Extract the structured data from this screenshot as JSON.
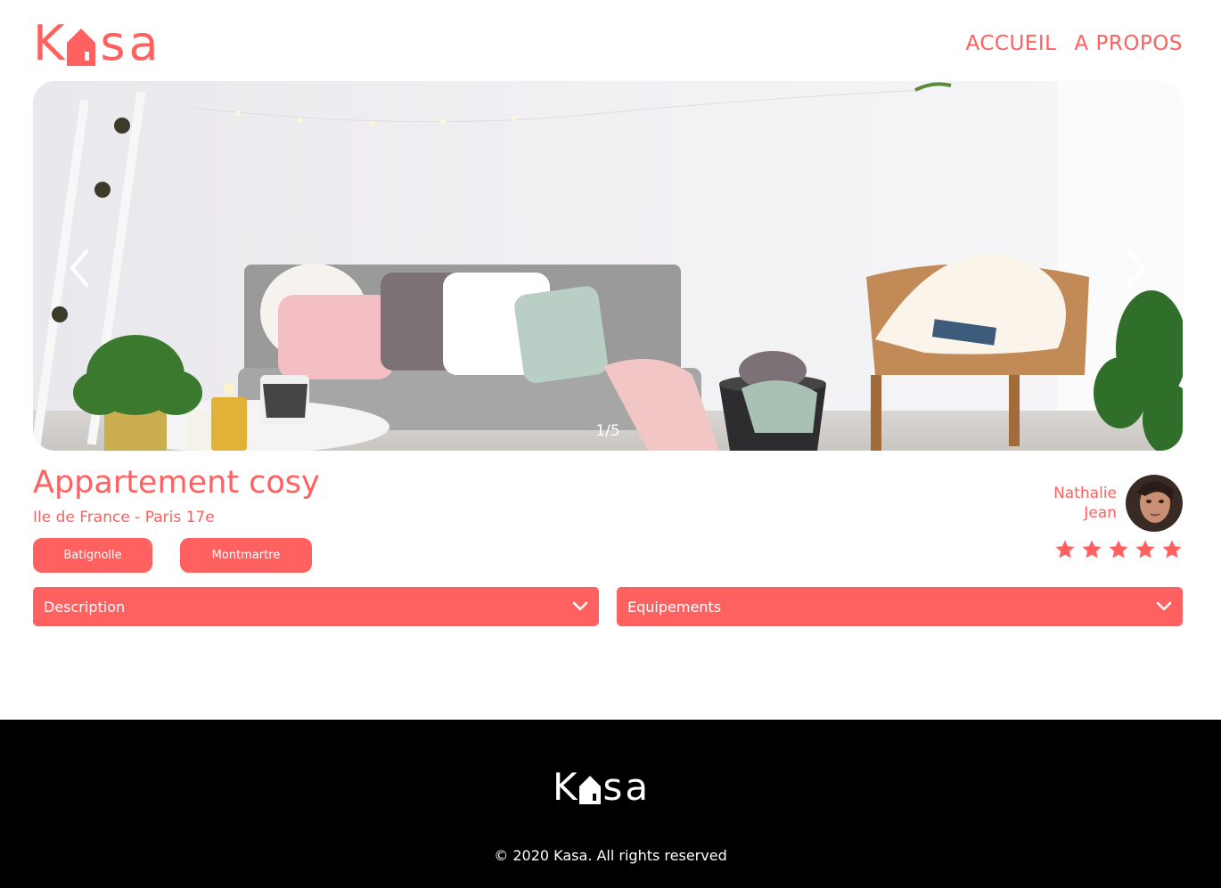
{
  "header": {
    "logo_text_left": "K",
    "logo_text_right": "sa",
    "nav": [
      {
        "label": "ACCUEIL"
      },
      {
        "label": "A PROPOS"
      }
    ]
  },
  "carousel": {
    "counter": "1/5",
    "prev_icon": "chevron-left-icon",
    "next_icon": "chevron-right-icon"
  },
  "listing": {
    "title": "Appartement cosy",
    "location": "Ile de France - Paris 17e",
    "tags": [
      "Batignolle",
      "Montmartre"
    ],
    "host": {
      "first_name": "Nathalie",
      "last_name": "Jean"
    },
    "rating": 5,
    "rating_max": 5
  },
  "collapses": [
    {
      "label": "Description",
      "icon": "chevron-down-icon"
    },
    {
      "label": "Equipements",
      "icon": "chevron-down-icon"
    }
  ],
  "footer": {
    "logo_text_left": "K",
    "logo_text_right": "sa",
    "copyright": "© 2020 Kasa. All rights reserved"
  },
  "colors": {
    "accent": "#FF6060",
    "footer_bg": "#000000",
    "star_inactive": "#E3E3E3"
  }
}
